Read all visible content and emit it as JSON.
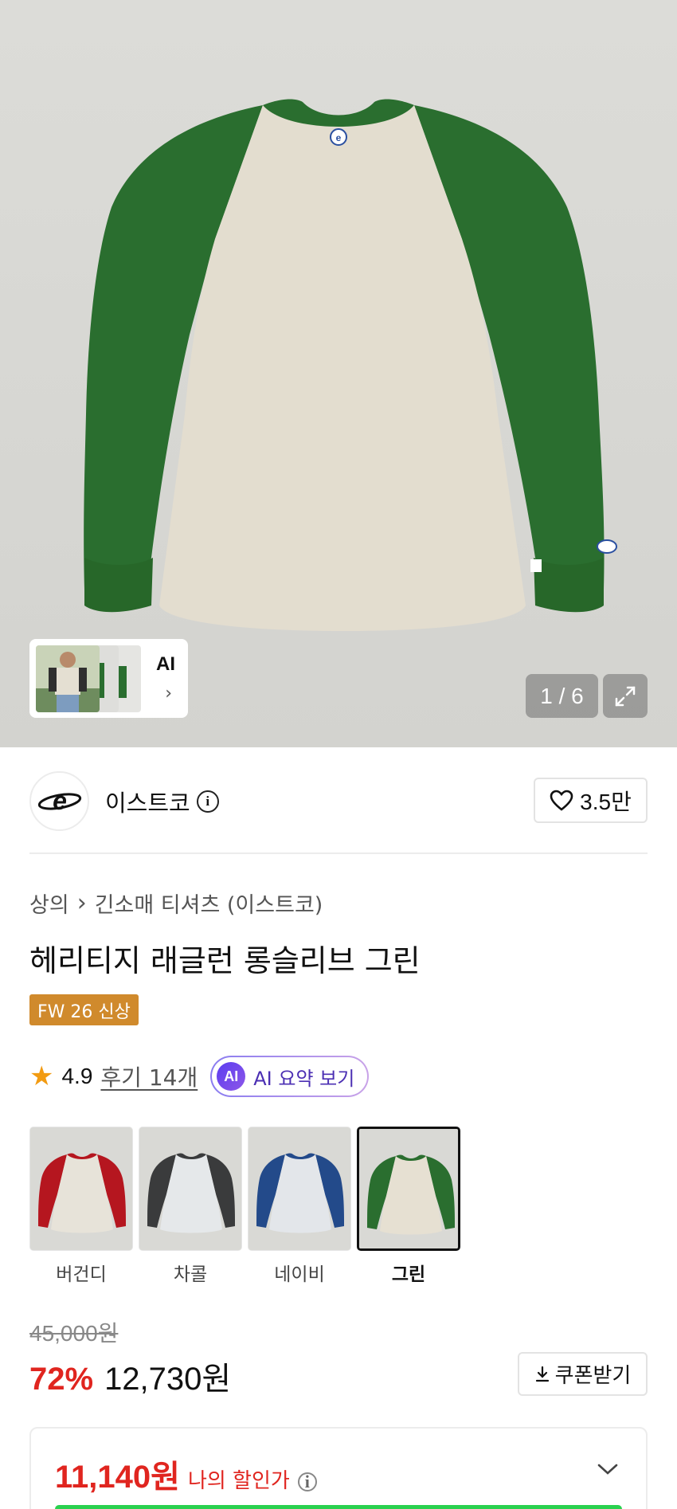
{
  "gallery": {
    "counter": "1 / 6",
    "ai_thumb_label": "AI",
    "ai_thumb_arrow": "›"
  },
  "brand": {
    "name": "이스트코",
    "likes": "3.5만"
  },
  "breadcrumb": {
    "level1": "상의",
    "separator": "›",
    "level2": "긴소매 티셔츠 (이스트코)"
  },
  "product": {
    "title": "헤리티지 래글런 롱슬리브 그린",
    "badge": "FW 26 신상"
  },
  "rating": {
    "score": "4.9",
    "reviews": "후기 14개",
    "ai_circle": "AI",
    "ai_summary": "AI 요약 보기"
  },
  "colors": [
    {
      "label": "버건디",
      "sleeve": "#b5161f",
      "body": "#e7e3d9",
      "selected": false
    },
    {
      "label": "차콜",
      "sleeve": "#3a3b3c",
      "body": "#e5e8ea",
      "selected": false
    },
    {
      "label": "네이비",
      "sleeve": "#234a8a",
      "body": "#e3e6ea",
      "selected": false
    },
    {
      "label": "그린",
      "sleeve": "#2a6e2f",
      "body": "#e6e0d2",
      "selected": true
    }
  ],
  "price": {
    "original": "45,000원",
    "discount_rate": "72%",
    "sale_price": "12,730원",
    "coupon_label": "쿠폰받기"
  },
  "my_discount": {
    "amount": "11,140원",
    "label": "나의 할인가"
  },
  "theme": {
    "sale_red": "#e0251f",
    "badge_orange": "#d08a2c",
    "sleeve_green": "#2a6e2f"
  }
}
